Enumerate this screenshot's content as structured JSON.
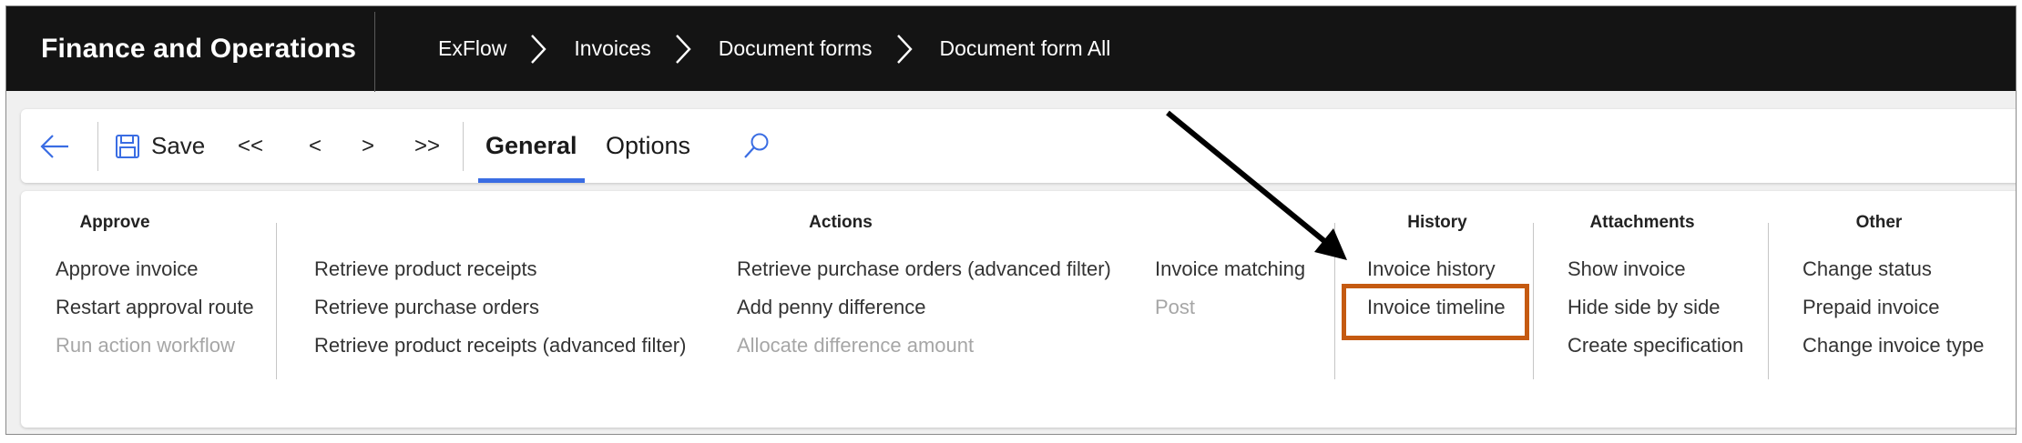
{
  "header": {
    "app_title": "Finance and Operations",
    "breadcrumb": [
      "ExFlow",
      "Invoices",
      "Document forms",
      "Document form All"
    ]
  },
  "toolbar": {
    "save_label": "Save",
    "first_label": "<<",
    "prev_label": "<",
    "next_label": ">",
    "last_label": ">>",
    "tabs": [
      {
        "label": "General",
        "active": true
      },
      {
        "label": "Options",
        "active": false
      }
    ]
  },
  "ribbon": {
    "approve": {
      "title": "Approve",
      "items": [
        {
          "label": "Approve invoice",
          "enabled": true
        },
        {
          "label": "Restart approval route",
          "enabled": true
        },
        {
          "label": "Run action workflow",
          "enabled": false
        }
      ]
    },
    "actions": {
      "title": "Actions",
      "col1": [
        {
          "label": "Retrieve product receipts",
          "enabled": true
        },
        {
          "label": "Retrieve purchase orders",
          "enabled": true
        },
        {
          "label": "Retrieve product receipts (advanced filter)",
          "enabled": true
        }
      ],
      "col2": [
        {
          "label": "Retrieve purchase orders (advanced filter)",
          "enabled": true
        },
        {
          "label": "Add penny difference",
          "enabled": true
        },
        {
          "label": "Allocate difference amount",
          "enabled": false
        }
      ],
      "col3": [
        {
          "label": "Invoice matching",
          "enabled": true
        },
        {
          "label": "Post",
          "enabled": false
        }
      ]
    },
    "history": {
      "title": "History",
      "items": [
        {
          "label": "Invoice history",
          "enabled": true
        },
        {
          "label": "Invoice timeline",
          "enabled": true,
          "highlighted": true
        }
      ]
    },
    "attachments": {
      "title": "Attachments",
      "items": [
        {
          "label": "Show invoice",
          "enabled": true
        },
        {
          "label": "Hide side by side",
          "enabled": true
        },
        {
          "label": "Create specification",
          "enabled": true
        }
      ]
    },
    "other": {
      "title": "Other",
      "items": [
        {
          "label": "Change status",
          "enabled": true
        },
        {
          "label": "Prepaid invoice",
          "enabled": true
        },
        {
          "label": "Change invoice type",
          "enabled": true
        }
      ]
    }
  },
  "colors": {
    "header_bg": "#141414",
    "accent": "#3a6de3",
    "highlight": "#c55a11",
    "disabled_text": "#a6a6a6"
  }
}
